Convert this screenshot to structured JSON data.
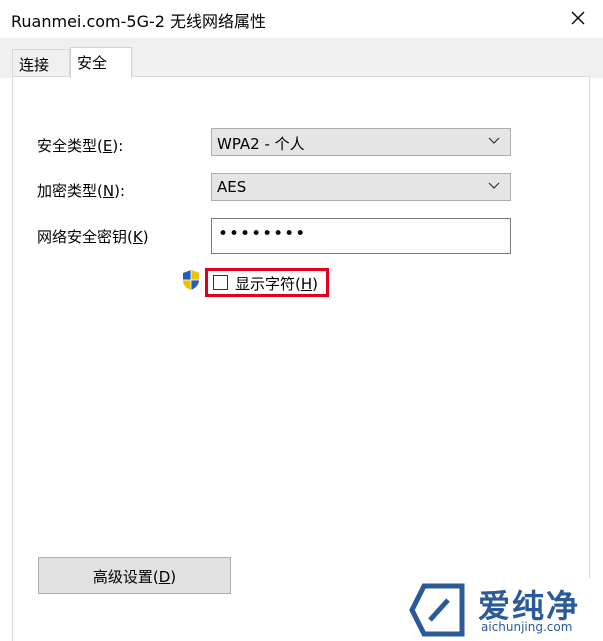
{
  "window": {
    "title": "Ruanmei.com-5G-2 无线网络属性",
    "close_glyph": "✕"
  },
  "tabs": [
    {
      "label": "连接",
      "selected": false
    },
    {
      "label": "安全",
      "selected": true
    }
  ],
  "security": {
    "type_label": "安全类型(",
    "type_key": "E",
    "type_suffix": "):",
    "type_value": "WPA2 - 个人",
    "encrypt_label": "加密类型(",
    "encrypt_key": "N",
    "encrypt_suffix": "):",
    "encrypt_value": "AES",
    "key_label": "网络安全密钥(",
    "key_key": "K",
    "key_suffix": ")",
    "key_value": "••••••••",
    "show_chars_label": "显示字符(",
    "show_chars_key": "H",
    "show_chars_suffix": ")",
    "show_chars_checked": false
  },
  "advanced_button": {
    "label": "高级设置(",
    "key": "D",
    "suffix": ")"
  },
  "watermark": {
    "brand_cn": "爱纯净",
    "url": "aichunjing.com"
  },
  "colors": {
    "highlight": "#e0001b",
    "watermark": "#2a5a9a"
  }
}
